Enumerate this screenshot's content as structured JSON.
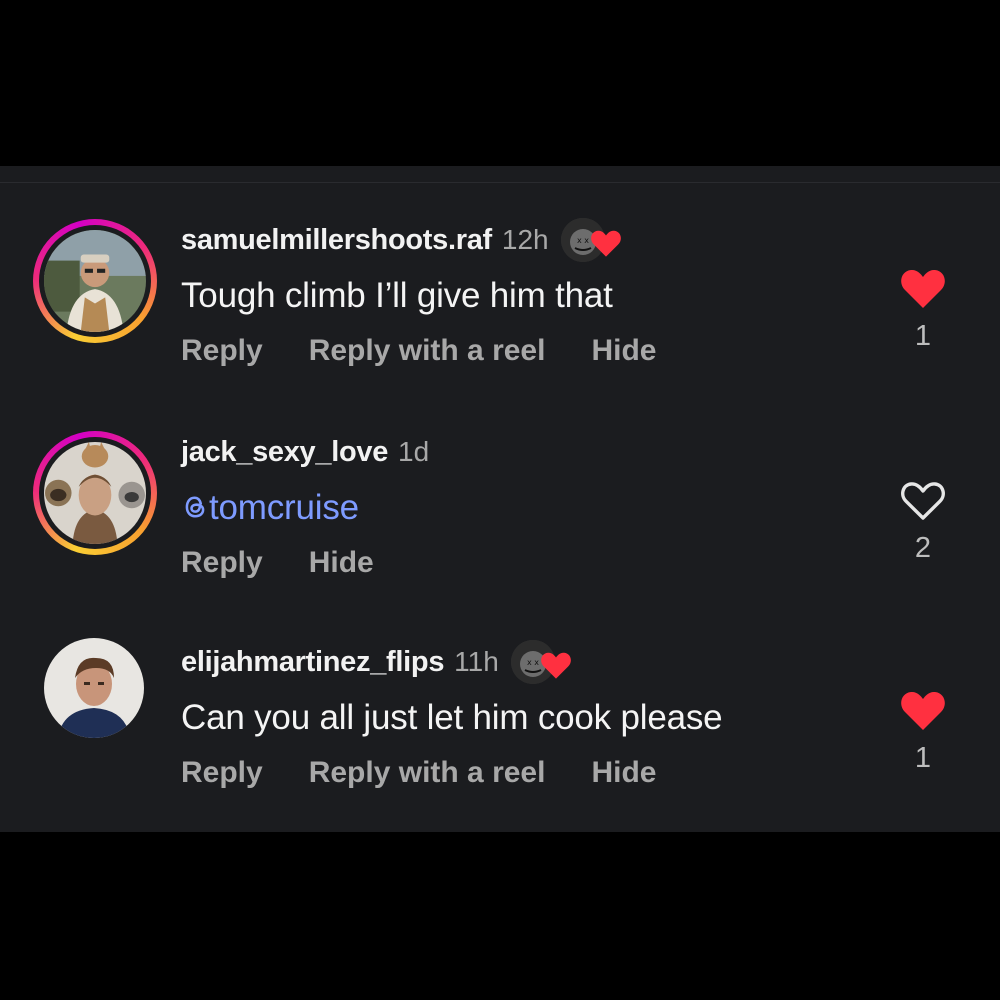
{
  "colors": {
    "panel_bg": "#1b1c1f",
    "heart_red": "#ff3040",
    "mention_blue": "#7e9bff",
    "muted_text": "#a8a8a8"
  },
  "comments": [
    {
      "username": "samuelmillershoots.raf",
      "time": "12h",
      "liked_by_author": true,
      "text": "Tough climb I’ll give him that",
      "actions": [
        "Reply",
        "Reply with a reel",
        "Hide"
      ],
      "liked": true,
      "like_count": "1",
      "avatar_icon": "avatar-story-ring"
    },
    {
      "username": "jack_sexy_love",
      "time": "1d",
      "liked_by_author": false,
      "mention_icon": "threads-icon",
      "text": "tomcruise",
      "actions": [
        "Reply",
        "Hide"
      ],
      "liked": false,
      "like_count": "2",
      "avatar_icon": "avatar-story-ring"
    },
    {
      "username": "elijahmartinez_flips",
      "time": "11h",
      "liked_by_author": true,
      "text": "Can you all just let him cook please",
      "actions": [
        "Reply",
        "Reply with a reel",
        "Hide"
      ],
      "liked": true,
      "like_count": "1",
      "avatar_icon": "avatar-plain"
    }
  ]
}
